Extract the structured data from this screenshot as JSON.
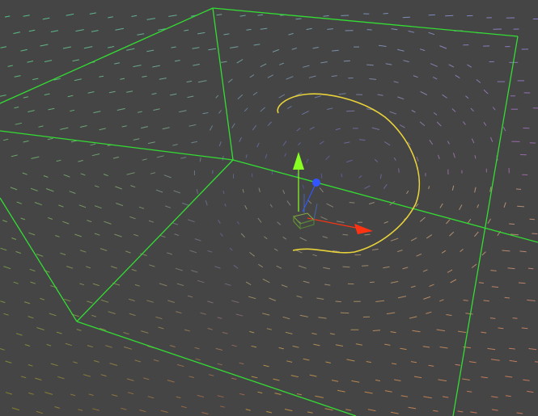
{
  "viewport": {
    "background_color": "#454545",
    "view": "perspective"
  },
  "bounding_box": {
    "color": "#33dd33"
  },
  "vector_field": {
    "type": "rotational",
    "color_scheme": "position-rgb",
    "colors": {
      "left": "#66cc44",
      "top": "#44bbcc",
      "center": "#3333aa",
      "right": "#cc44cc",
      "bottom": "#aa3311",
      "front": "#dddd33"
    }
  },
  "streamline": {
    "color": "#e8d23a",
    "shape": "closed-loop"
  },
  "transform_gizmo": {
    "axes": [
      {
        "axis": "x",
        "color": "#ff3311",
        "icon": "x-axis-cone-icon"
      },
      {
        "axis": "y",
        "color": "#88ff22",
        "icon": "y-axis-cone-icon"
      },
      {
        "axis": "z",
        "color": "#3355ff",
        "icon": "z-axis-sphere-icon"
      }
    ],
    "center_icon": "pivot-cube-icon"
  }
}
